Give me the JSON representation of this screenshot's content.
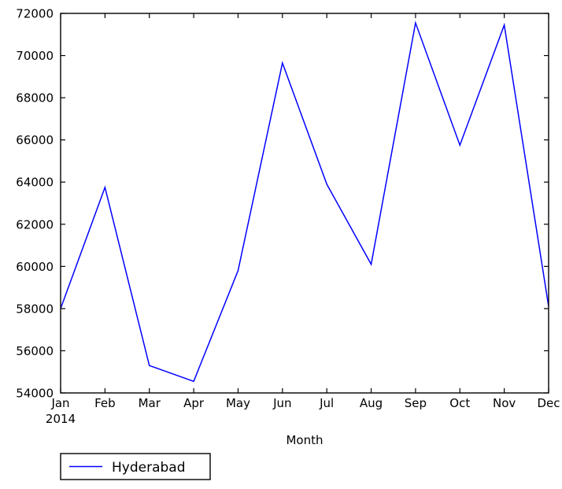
{
  "chart_data": {
    "type": "line",
    "title": "",
    "xlabel": "Month",
    "ylabel": "",
    "categories": [
      "Jan",
      "Feb",
      "Mar",
      "Apr",
      "May",
      "Jun",
      "Jul",
      "Aug",
      "Sep",
      "Oct",
      "Nov",
      "Dec"
    ],
    "x_sublabel": "2014",
    "series": [
      {
        "name": "Hyderabad",
        "color": "#0000ff",
        "values": [
          58000,
          63750,
          55300,
          54550,
          59800,
          69650,
          63900,
          60100,
          71550,
          65750,
          71450,
          58100
        ]
      }
    ],
    "ylim": [
      54000,
      72000
    ],
    "y_ticks": [
      54000,
      56000,
      58000,
      60000,
      62000,
      64000,
      66000,
      68000,
      70000,
      72000
    ],
    "y_tick_labels": [
      "54000",
      "56000",
      "58000",
      "60000",
      "62000",
      "64000",
      "66000",
      "68000",
      "70000",
      "72000"
    ],
    "xlim_index": [
      0,
      11
    ],
    "grid": false,
    "legend_position": "below-left",
    "legend_entries": [
      "Hyderabad"
    ],
    "axis_color": "#000000",
    "background_color": "#ffffff"
  },
  "legend": {
    "items": [
      {
        "label": "Hyderabad",
        "color": "#0000ff"
      }
    ]
  },
  "axes": {
    "x_title": "Month",
    "x_sublabel": "2014"
  }
}
